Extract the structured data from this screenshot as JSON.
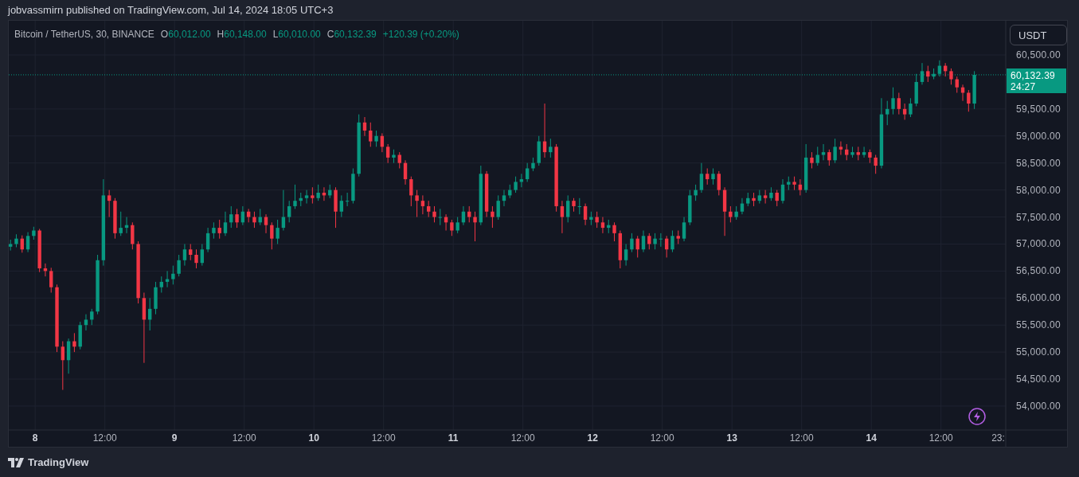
{
  "header": {
    "published": "jobvassmirn published on TradingView.com, Jul 14, 2024 18:05 UTC+3"
  },
  "legend": {
    "symbol": "Bitcoin / TetherUS, 30, BINANCE",
    "ohlc": [
      {
        "label": "O",
        "value": "60,012.00"
      },
      {
        "label": "H",
        "value": "60,148.00"
      },
      {
        "label": "L",
        "value": "60,010.00"
      },
      {
        "label": "C",
        "value": "60,132.39"
      }
    ],
    "change": "+120.39 (+0.20%)"
  },
  "currency_button": {
    "label": "USDT"
  },
  "chart_data": {
    "type": "candlestick",
    "categories": [
      null,
      null,
      null,
      null,
      null,
      null,
      null,
      null,
      null,
      null,
      null,
      null,
      null,
      null,
      null,
      null,
      null,
      null,
      null,
      null,
      null,
      null,
      null,
      null,
      null,
      null,
      null,
      null,
      null,
      null,
      null,
      null,
      null,
      null,
      null,
      null,
      null,
      null,
      null,
      null,
      null,
      null,
      null,
      null,
      null,
      null,
      null,
      null,
      null,
      null,
      null,
      null,
      null,
      null,
      null,
      null,
      null,
      null,
      null,
      null,
      null,
      null,
      null,
      null,
      null,
      null,
      null,
      null,
      null,
      null,
      null,
      null,
      null,
      null,
      null,
      null,
      null,
      null,
      null,
      null,
      null,
      null,
      null,
      null,
      null,
      null,
      null,
      null,
      null,
      null,
      null,
      null,
      null,
      null,
      null,
      null,
      null,
      null,
      null,
      null,
      null,
      null,
      null,
      null,
      null,
      null,
      null,
      null,
      null,
      null,
      null,
      null,
      null,
      null,
      null,
      null,
      null,
      null,
      null,
      null,
      null,
      null,
      null,
      null,
      null,
      null,
      null,
      null,
      null,
      null,
      null,
      null,
      null,
      null,
      null,
      null,
      null,
      null,
      null,
      null,
      null,
      null,
      null,
      null,
      null,
      null,
      null,
      null,
      null,
      null,
      null,
      null,
      null,
      null,
      null,
      null,
      null,
      null,
      null,
      null,
      null,
      null,
      null,
      null,
      null,
      null,
      null
    ],
    "ohlc": [
      [
        56950,
        57080,
        56880,
        57000
      ],
      [
        57000,
        57180,
        56940,
        57100
      ],
      [
        57100,
        57160,
        56840,
        56900
      ],
      [
        56900,
        57220,
        56850,
        57150
      ],
      [
        57150,
        57320,
        57080,
        57250
      ],
      [
        57250,
        57280,
        56480,
        56550
      ],
      [
        56550,
        56640,
        56400,
        56500
      ],
      [
        56500,
        56560,
        56100,
        56200
      ],
      [
        56200,
        56250,
        55000,
        55100
      ],
      [
        55100,
        55200,
        54300,
        54850
      ],
      [
        54850,
        55250,
        54600,
        55200
      ],
      [
        55200,
        55350,
        55000,
        55100
      ],
      [
        55100,
        55560,
        55050,
        55500
      ],
      [
        55500,
        55700,
        55400,
        55600
      ],
      [
        55600,
        55800,
        55500,
        55750
      ],
      [
        55750,
        56800,
        55700,
        56700
      ],
      [
        56700,
        58200,
        56600,
        57900
      ],
      [
        57900,
        58000,
        57500,
        57800
      ],
      [
        57800,
        57850,
        57100,
        57200
      ],
      [
        57200,
        57600,
        57150,
        57300
      ],
      [
        57300,
        57500,
        57200,
        57350
      ],
      [
        57350,
        57400,
        56900,
        57000
      ],
      [
        57000,
        57050,
        55900,
        56000
      ],
      [
        56000,
        56100,
        54800,
        55600
      ],
      [
        55600,
        56000,
        55400,
        55800
      ],
      [
        55800,
        56300,
        55700,
        56200
      ],
      [
        56200,
        56400,
        56100,
        56300
      ],
      [
        56300,
        56500,
        56200,
        56350
      ],
      [
        56350,
        56600,
        56250,
        56450
      ],
      [
        56450,
        56800,
        56400,
        56700
      ],
      [
        56700,
        57000,
        56600,
        56900
      ],
      [
        56900,
        57000,
        56700,
        56800
      ],
      [
        56800,
        56900,
        56550,
        56650
      ],
      [
        56650,
        57000,
        56600,
        56900
      ],
      [
        56900,
        57300,
        56850,
        57200
      ],
      [
        57200,
        57400,
        57100,
        57300
      ],
      [
        57300,
        57450,
        57100,
        57200
      ],
      [
        57200,
        57600,
        57150,
        57400
      ],
      [
        57400,
        57700,
        57300,
        57550
      ],
      [
        57550,
        57650,
        57300,
        57400
      ],
      [
        57400,
        57700,
        57350,
        57600
      ],
      [
        57600,
        57650,
        57400,
        57500
      ],
      [
        57500,
        57600,
        57300,
        57400
      ],
      [
        57400,
        57650,
        57350,
        57500
      ],
      [
        57500,
        57550,
        57200,
        57350
      ],
      [
        57350,
        57400,
        56900,
        57100
      ],
      [
        57100,
        57450,
        57000,
        57300
      ],
      [
        57300,
        58000,
        57250,
        57500
      ],
      [
        57500,
        57800,
        57400,
        57700
      ],
      [
        57700,
        58100,
        57650,
        57800
      ],
      [
        57800,
        57950,
        57700,
        57850
      ],
      [
        57850,
        58000,
        57750,
        57900
      ],
      [
        57900,
        58050,
        57750,
        57850
      ],
      [
        57850,
        58100,
        57800,
        57950
      ],
      [
        57950,
        58050,
        57800,
        57900
      ],
      [
        57900,
        58100,
        57850,
        58000
      ],
      [
        58000,
        58050,
        57300,
        57600
      ],
      [
        57600,
        57900,
        57500,
        57800
      ],
      [
        57800,
        57950,
        57700,
        57800
      ],
      [
        57800,
        58400,
        57750,
        58300
      ],
      [
        58300,
        59400,
        58250,
        59250
      ],
      [
        59250,
        59350,
        59000,
        59100
      ],
      [
        59100,
        59250,
        58800,
        58900
      ],
      [
        58900,
        59100,
        58800,
        59000
      ],
      [
        59000,
        59050,
        58700,
        58800
      ],
      [
        58800,
        58850,
        58500,
        58600
      ],
      [
        58600,
        58750,
        58500,
        58650
      ],
      [
        58650,
        58700,
        58400,
        58500
      ],
      [
        58500,
        58550,
        58100,
        58200
      ],
      [
        58200,
        58250,
        57700,
        57900
      ],
      [
        57900,
        58000,
        57500,
        57800
      ],
      [
        57800,
        57900,
        57550,
        57700
      ],
      [
        57700,
        57800,
        57500,
        57600
      ],
      [
        57600,
        57700,
        57400,
        57500
      ],
      [
        57500,
        57650,
        57350,
        57500
      ],
      [
        57500,
        57550,
        57250,
        57400
      ],
      [
        57400,
        57450,
        57150,
        57250
      ],
      [
        57250,
        57500,
        57200,
        57400
      ],
      [
        57400,
        57700,
        57350,
        57600
      ],
      [
        57600,
        57700,
        57400,
        57500
      ],
      [
        57500,
        57600,
        57050,
        57400
      ],
      [
        57400,
        58450,
        57350,
        58300
      ],
      [
        58300,
        58350,
        57500,
        57600
      ],
      [
        57600,
        57700,
        57300,
        57500
      ],
      [
        57500,
        57900,
        57450,
        57800
      ],
      [
        57800,
        58000,
        57700,
        57900
      ],
      [
        57900,
        58100,
        57850,
        58000
      ],
      [
        58000,
        58250,
        57950,
        58150
      ],
      [
        58150,
        58300,
        58050,
        58200
      ],
      [
        58200,
        58500,
        58150,
        58400
      ],
      [
        58400,
        58600,
        58350,
        58500
      ],
      [
        58500,
        59000,
        58450,
        58900
      ],
      [
        58900,
        59600,
        58600,
        58700
      ],
      [
        58700,
        58950,
        58600,
        58800
      ],
      [
        58800,
        58850,
        57600,
        57700
      ],
      [
        57700,
        57800,
        57200,
        57500
      ],
      [
        57500,
        57900,
        57400,
        57800
      ],
      [
        57800,
        57850,
        57600,
        57700
      ],
      [
        57700,
        57850,
        57550,
        57700
      ],
      [
        57700,
        57750,
        57350,
        57450
      ],
      [
        57450,
        57600,
        57350,
        57500
      ],
      [
        57500,
        57600,
        57300,
        57400
      ],
      [
        57400,
        57500,
        57200,
        57300
      ],
      [
        57300,
        57450,
        57200,
        57350
      ],
      [
        57350,
        57400,
        57050,
        57200
      ],
      [
        57200,
        57250,
        56550,
        56700
      ],
      [
        56700,
        57000,
        56600,
        56900
      ],
      [
        56900,
        57200,
        56850,
        57100
      ],
      [
        57100,
        57150,
        56750,
        56900
      ],
      [
        56900,
        57250,
        56850,
        57150
      ],
      [
        57150,
        57200,
        56900,
        57000
      ],
      [
        57000,
        57200,
        56900,
        57100
      ],
      [
        57100,
        57200,
        56950,
        57100
      ],
      [
        57100,
        57150,
        56750,
        56900
      ],
      [
        56900,
        57250,
        56850,
        57150
      ],
      [
        57150,
        57250,
        57000,
        57100
      ],
      [
        57100,
        57500,
        57050,
        57400
      ],
      [
        57400,
        58000,
        57350,
        57900
      ],
      [
        57900,
        58100,
        57800,
        58000
      ],
      [
        58000,
        58500,
        57950,
        58300
      ],
      [
        58300,
        58400,
        58100,
        58200
      ],
      [
        58200,
        58400,
        58100,
        58300
      ],
      [
        58300,
        58350,
        57900,
        58000
      ],
      [
        58000,
        58050,
        57150,
        57600
      ],
      [
        57600,
        57700,
        57400,
        57500
      ],
      [
        57500,
        57700,
        57450,
        57600
      ],
      [
        57600,
        57850,
        57550,
        57750
      ],
      [
        57750,
        57950,
        57700,
        57850
      ],
      [
        57850,
        57950,
        57700,
        57800
      ],
      [
        57800,
        58000,
        57750,
        57900
      ],
      [
        57900,
        58000,
        57750,
        57850
      ],
      [
        57850,
        58050,
        57800,
        57950
      ],
      [
        57950,
        58000,
        57700,
        57800
      ],
      [
        57800,
        58200,
        57750,
        58100
      ],
      [
        58100,
        58250,
        58000,
        58150
      ],
      [
        58150,
        58250,
        58000,
        58100
      ],
      [
        58100,
        58200,
        57900,
        58000
      ],
      [
        58000,
        58850,
        57950,
        58600
      ],
      [
        58600,
        58700,
        58400,
        58500
      ],
      [
        58500,
        58800,
        58450,
        58650
      ],
      [
        58650,
        58850,
        58550,
        58700
      ],
      [
        58700,
        58750,
        58450,
        58550
      ],
      [
        58550,
        58950,
        58500,
        58800
      ],
      [
        58800,
        58900,
        58650,
        58750
      ],
      [
        58750,
        58850,
        58550,
        58650
      ],
      [
        58650,
        58800,
        58600,
        58700
      ],
      [
        58700,
        58800,
        58550,
        58650
      ],
      [
        58650,
        58800,
        58600,
        58700
      ],
      [
        58700,
        58750,
        58500,
        58600
      ],
      [
        58600,
        58650,
        58300,
        58450
      ],
      [
        58450,
        59700,
        58400,
        59400
      ],
      [
        59400,
        59650,
        59200,
        59500
      ],
      [
        59500,
        59900,
        59400,
        59700
      ],
      [
        59700,
        59800,
        59400,
        59500
      ],
      [
        59500,
        59600,
        59300,
        59400
      ],
      [
        59400,
        59700,
        59350,
        59600
      ],
      [
        59600,
        60150,
        59550,
        60000
      ],
      [
        60000,
        60350,
        59950,
        60200
      ],
      [
        60200,
        60300,
        60000,
        60100
      ],
      [
        60100,
        60250,
        60050,
        60150
      ],
      [
        60150,
        60400,
        60100,
        60300
      ],
      [
        60300,
        60350,
        60100,
        60200
      ],
      [
        60200,
        60250,
        59950,
        60050
      ],
      [
        60050,
        60100,
        59800,
        59900
      ],
      [
        59900,
        59950,
        59650,
        59800
      ],
      [
        59800,
        59850,
        59450,
        59600
      ],
      [
        59600,
        60200,
        59500,
        60132.39
      ]
    ],
    "ylim": [
      53557,
      61134
    ],
    "grid": true,
    "ref_lines": [
      {
        "axis": "y",
        "value": 60132.39,
        "color": "#089981"
      }
    ],
    "yticks": [
      {
        "value": 60500,
        "label": "60,500.00"
      },
      {
        "value": 59500,
        "label": "59,500.00"
      },
      {
        "value": 59000,
        "label": "59,000.00"
      },
      {
        "value": 58500,
        "label": "58,500.00"
      },
      {
        "value": 58000,
        "label": "58,000.00"
      },
      {
        "value": 57500,
        "label": "57,500.00"
      },
      {
        "value": 57000,
        "label": "57,000.00"
      },
      {
        "value": 56500,
        "label": "56,500.00"
      },
      {
        "value": 56000,
        "label": "56,000.00"
      },
      {
        "value": 55500,
        "label": "55,500.00"
      },
      {
        "value": 55000,
        "label": "55,000.00"
      },
      {
        "value": 54500,
        "label": "54,500.00"
      },
      {
        "value": 54000,
        "label": "54,000.00"
      }
    ]
  },
  "time_axis": {
    "labels": [
      {
        "text": "8",
        "kind": "day"
      },
      {
        "text": "12:00",
        "kind": "time"
      },
      {
        "text": "9",
        "kind": "day"
      },
      {
        "text": "12:00",
        "kind": "time"
      },
      {
        "text": "10",
        "kind": "day"
      },
      {
        "text": "12:00",
        "kind": "time"
      },
      {
        "text": "11",
        "kind": "day"
      },
      {
        "text": "12:00",
        "kind": "time"
      },
      {
        "text": "12",
        "kind": "day"
      },
      {
        "text": "12:00",
        "kind": "time"
      },
      {
        "text": "13",
        "kind": "day"
      },
      {
        "text": "12:00",
        "kind": "time"
      },
      {
        "text": "14",
        "kind": "day"
      },
      {
        "text": "12:00",
        "kind": "time"
      },
      {
        "text": "23:",
        "kind": "time"
      }
    ]
  },
  "last_price": {
    "price": "60,132.39",
    "countdown": "24:27"
  },
  "footer": {
    "brand": "TradingView"
  }
}
